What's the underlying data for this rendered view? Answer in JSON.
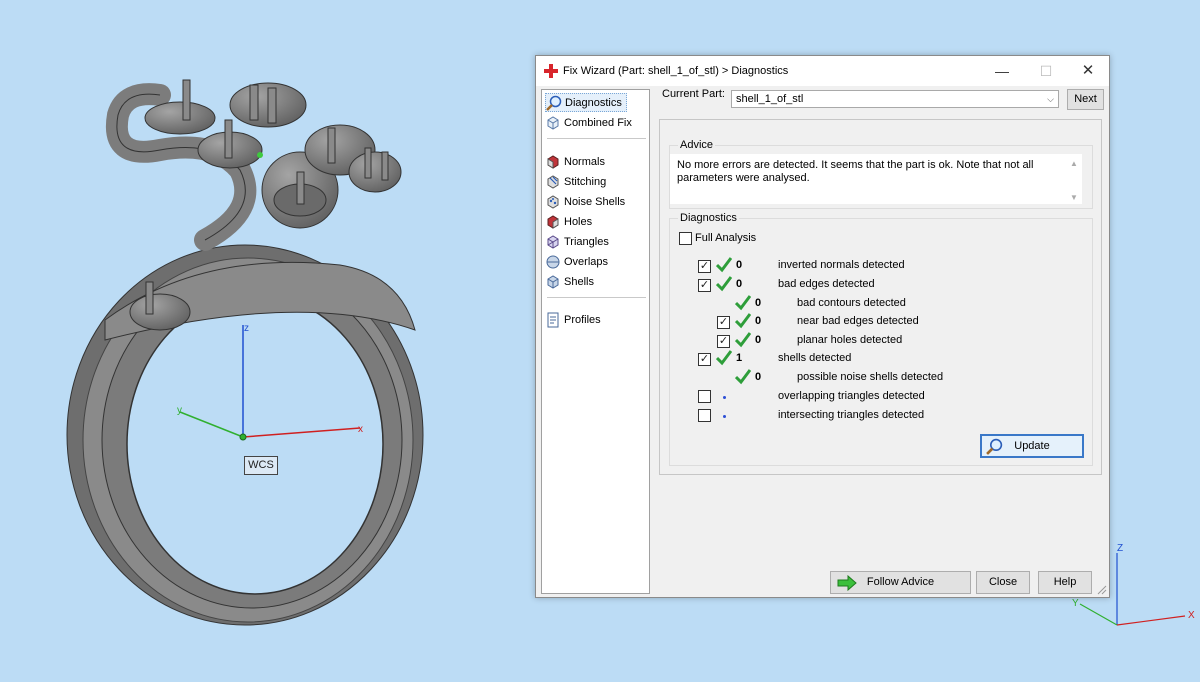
{
  "viewport": {
    "wcs_label": "WCS",
    "main_axes": {
      "z": "z",
      "y": "y",
      "x": "x"
    },
    "corner_axes": {
      "z": "Z",
      "y": "Y",
      "x": "X"
    }
  },
  "window": {
    "title": "Fix Wizard (Part: shell_1_of_stl) > Diagnostics",
    "minimize": "—",
    "maximize": "☐",
    "close": "✕"
  },
  "sidebar": {
    "items": [
      {
        "label": "Diagnostics",
        "icon": "magnifier-icon"
      },
      {
        "label": "Combined Fix",
        "icon": "cube-fix-icon"
      },
      {
        "label": "Normals",
        "icon": "normals-icon"
      },
      {
        "label": "Stitching",
        "icon": "stitching-icon"
      },
      {
        "label": "Noise Shells",
        "icon": "noise-shells-icon"
      },
      {
        "label": "Holes",
        "icon": "holes-icon"
      },
      {
        "label": "Triangles",
        "icon": "triangles-icon"
      },
      {
        "label": "Overlaps",
        "icon": "overlaps-icon"
      },
      {
        "label": "Shells",
        "icon": "shells-icon"
      },
      {
        "label": "Profiles",
        "icon": "profiles-icon"
      }
    ]
  },
  "current_part": {
    "label": "Current Part:",
    "value": "shell_1_of_stl",
    "next_label": "Next"
  },
  "advice": {
    "title": "Advice",
    "text_line1": "No more errors are detected. It seems that the part is ok. Note that not all",
    "text_line2": "parameters were analysed."
  },
  "diagnostics": {
    "title": "Diagnostics",
    "full_analysis_label": "Full Analysis",
    "rows": [
      {
        "checkbox": "checked",
        "status": "ok",
        "count": "0",
        "label": "inverted normals detected"
      },
      {
        "checkbox": "checked",
        "status": "ok",
        "count": "0",
        "label": "bad edges detected"
      },
      {
        "checkbox": "none",
        "status": "ok",
        "count": "0",
        "label": "bad contours detected"
      },
      {
        "checkbox": "checked",
        "status": "ok",
        "count": "0",
        "label": "near bad edges detected"
      },
      {
        "checkbox": "checked",
        "status": "ok",
        "count": "0",
        "label": "planar holes detected"
      },
      {
        "checkbox": "checked",
        "status": "ok",
        "count": "1",
        "label": "shells detected"
      },
      {
        "checkbox": "none",
        "status": "ok",
        "count": "0",
        "label": "possible noise shells detected"
      },
      {
        "checkbox": "unchecked",
        "status": "dot",
        "count": "",
        "label": "overlapping triangles detected"
      },
      {
        "checkbox": "unchecked",
        "status": "dot",
        "count": "",
        "label": "intersecting triangles detected"
      }
    ],
    "update_label": "Update"
  },
  "footer": {
    "follow_advice_label": "Follow Advice",
    "close_label": "Close",
    "help_label": "Help"
  },
  "colors": {
    "background": "#bcdcf5",
    "check_green": "#2e9e3a",
    "model_gray": "#7a7a7a",
    "axis_red": "#d02020",
    "axis_green": "#30b030",
    "axis_blue": "#2050d0"
  }
}
